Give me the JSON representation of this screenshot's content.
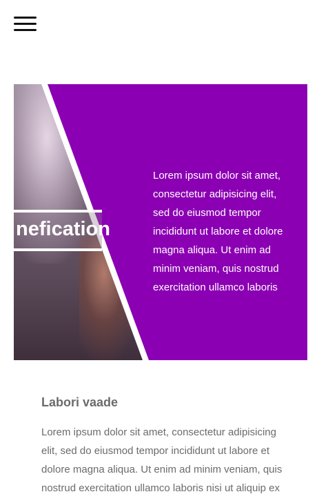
{
  "header": {
    "menu_icon": "hamburger-menu-icon"
  },
  "hero": {
    "banner_text": "nefication",
    "paragraph": "Lorem ipsum dolor sit amet, consectetur adipisicing elit, sed do eiusmod tempor incididunt ut labore et dolore magna aliqua. Ut enim ad minim veniam, quis nostrud exercitation ullamco laboris",
    "accent_color": "#8b00b3"
  },
  "section": {
    "title": "Labori vaade",
    "body": "Lorem ipsum dolor sit amet, consectetur adipisicing elit, sed do eiusmod tempor incididunt ut labore et dolore magna aliqua. Ut enim ad minim veniam, quis nostrud exercitation ullamco laboris nisi ut aliquip ex"
  }
}
